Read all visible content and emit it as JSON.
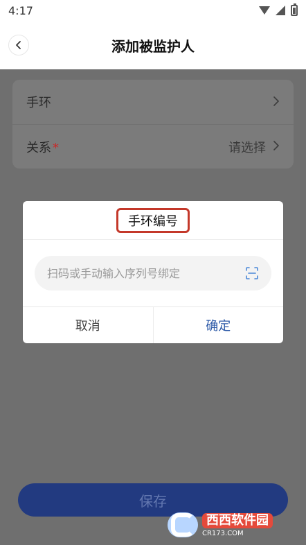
{
  "status_bar": {
    "time": "4:17"
  },
  "header": {
    "title": "添加被监护人"
  },
  "form": {
    "rows": [
      {
        "label": "手环",
        "value": ""
      },
      {
        "label": "关系",
        "value": "请选择",
        "required_mark": "*"
      }
    ]
  },
  "dialog": {
    "title": "手环编号",
    "input_placeholder": "扫码或手动输入序列号绑定",
    "cancel_label": "取消",
    "confirm_label": "确定"
  },
  "footer": {
    "save_label": "保存"
  },
  "watermark": {
    "cn": "西西软件园",
    "en": "CR173.COM"
  },
  "colors": {
    "primary": "#2d5aa8",
    "required": "#c82a2a",
    "highlight_border": "#c4382a",
    "overlay": "#6f6f6f"
  }
}
